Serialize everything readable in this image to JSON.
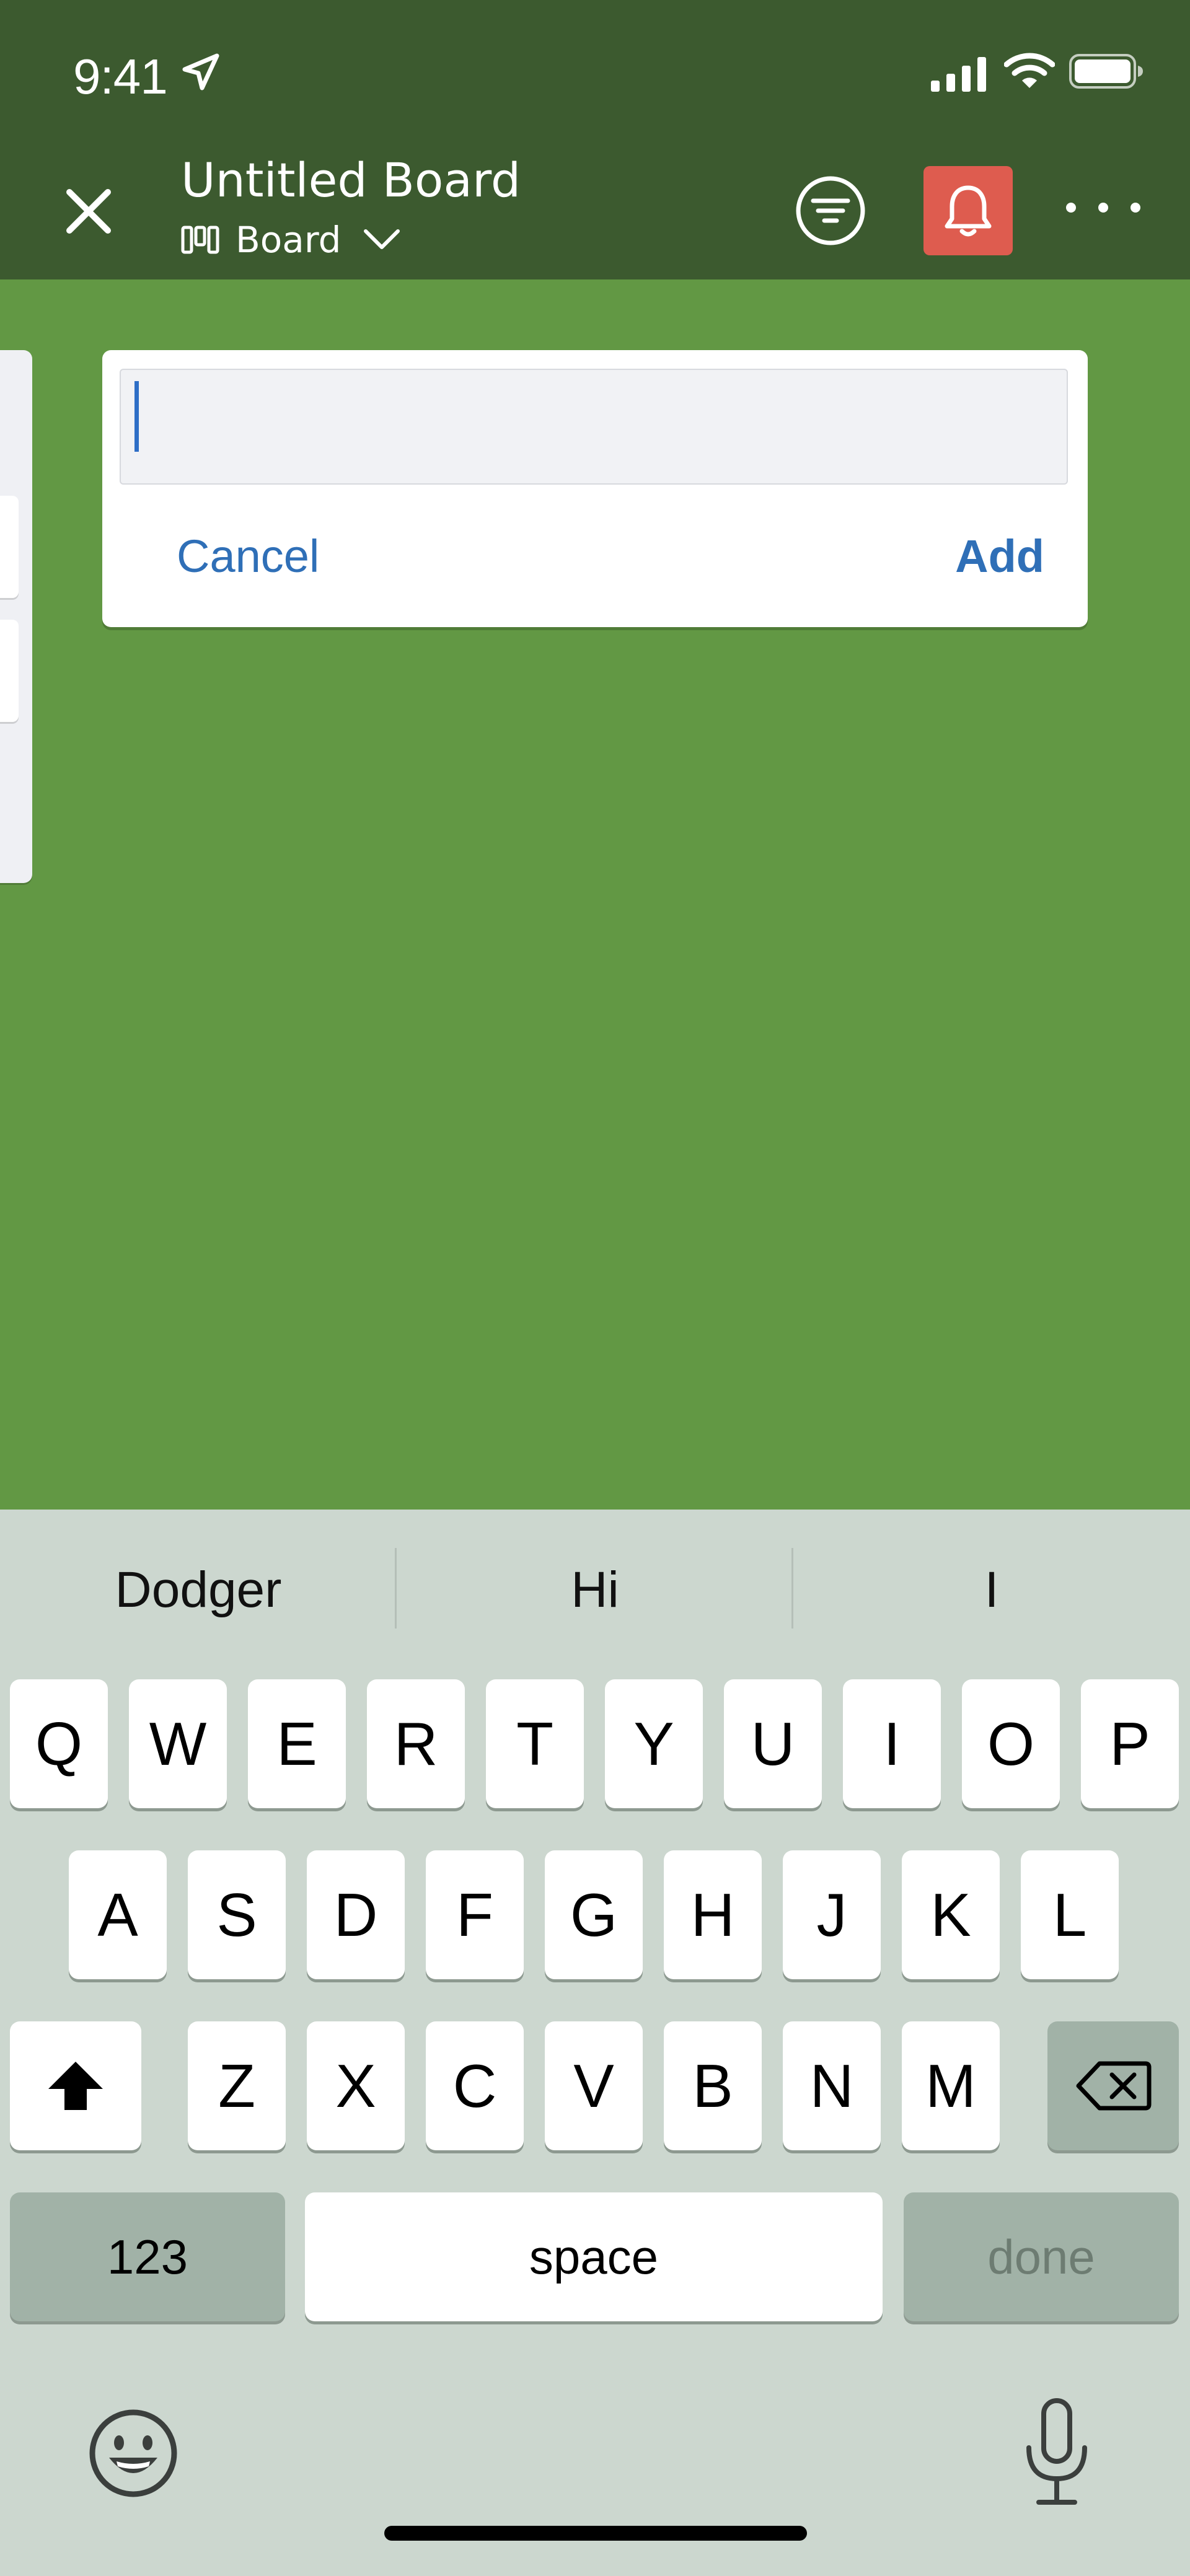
{
  "status_bar": {
    "time": "9:41"
  },
  "header": {
    "board_title": "Untitled Board",
    "board_type": "Board"
  },
  "add_list": {
    "input_value": "",
    "cancel_label": "Cancel",
    "add_label": "Add"
  },
  "keyboard": {
    "suggestions": [
      "Dodger",
      "Hi",
      "I"
    ],
    "row1": [
      "Q",
      "W",
      "E",
      "R",
      "T",
      "Y",
      "U",
      "I",
      "O",
      "P"
    ],
    "row2": [
      "A",
      "S",
      "D",
      "F",
      "G",
      "H",
      "J",
      "K",
      "L"
    ],
    "row3": [
      "Z",
      "X",
      "C",
      "V",
      "B",
      "N",
      "M"
    ],
    "numbers_label": "123",
    "space_label": "space",
    "done_label": "done"
  },
  "colors": {
    "header_bg": "#3c5a2f",
    "board_bg": "#629844",
    "bell_bg": "#de5c4f",
    "link_blue": "#2f6fb7",
    "keyboard_bg": "#ccd7cf"
  },
  "icons": {
    "close": "close-icon",
    "board_type": "board-columns-icon",
    "dropdown": "chevron-down-icon",
    "filter": "filter-icon",
    "notifications": "bell-icon",
    "more": "more-horizontal-icon",
    "shift": "shift-icon",
    "delete": "backspace-icon",
    "emoji": "emoji-icon",
    "mic": "microphone-icon"
  }
}
